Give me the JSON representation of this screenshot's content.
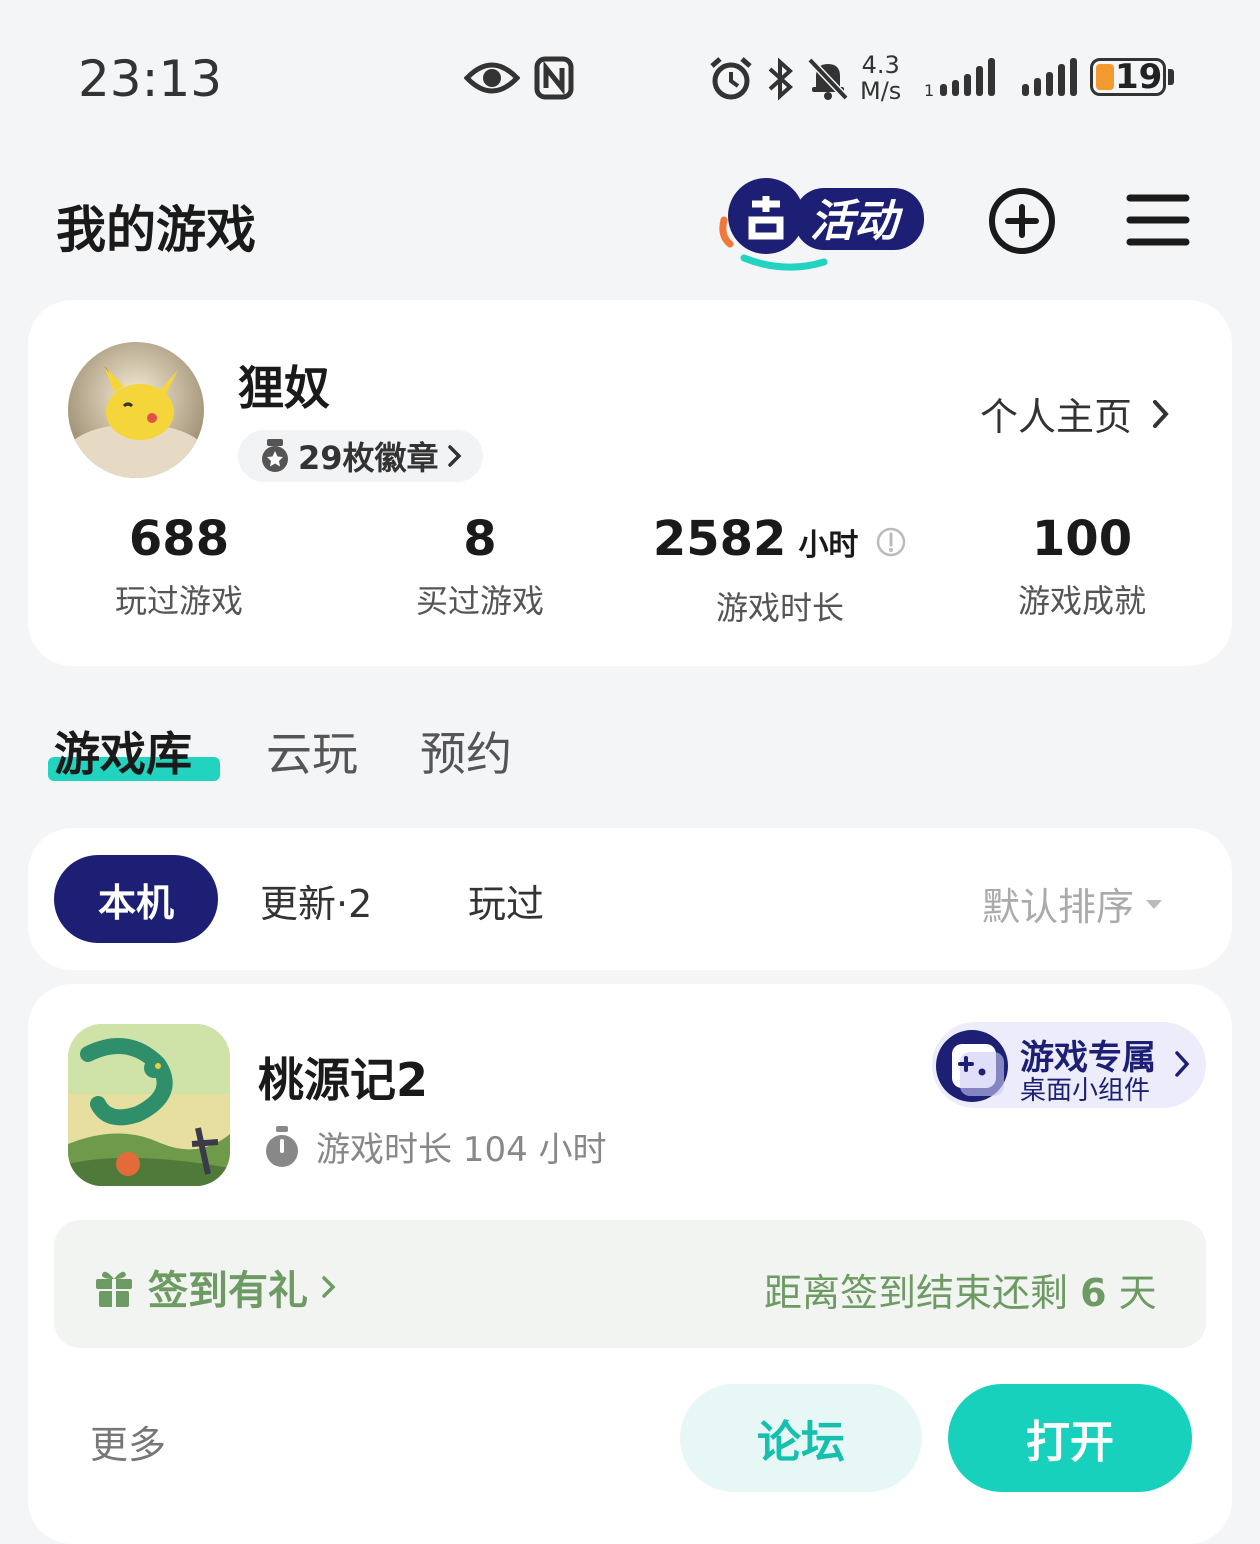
{
  "status_bar": {
    "time": "23:13",
    "speed_value": "4.3",
    "speed_unit": "M/s",
    "battery": "19",
    "icons": [
      "eye-icon",
      "nfc-icon",
      "alarm-icon",
      "bluetooth-icon",
      "mute-bell-icon",
      "signal-icon",
      "signal-icon"
    ]
  },
  "header": {
    "title": "我的游戏",
    "activity_badge_label": "活动"
  },
  "profile": {
    "username": "狸奴",
    "badges_label": "29枚徽章",
    "homepage_label": "个人主页",
    "stats": [
      {
        "value": "688",
        "unit": "",
        "label": "玩过游戏"
      },
      {
        "value": "8",
        "unit": "",
        "label": "买过游戏"
      },
      {
        "value": "2582",
        "unit": "小时",
        "label": "游戏时长"
      },
      {
        "value": "100",
        "unit": "",
        "label": "游戏成就"
      }
    ]
  },
  "tabs": [
    {
      "label": "游戏库",
      "active": true
    },
    {
      "label": "云玩",
      "active": false
    },
    {
      "label": "预约",
      "active": false
    }
  ],
  "filters": {
    "chips": [
      "本机",
      "更新·2",
      "玩过"
    ],
    "active": "本机",
    "sort_label": "默认排序"
  },
  "game": {
    "name": "桃源记2",
    "playtime": "游戏时长 104 小时",
    "widget_title": "游戏专属",
    "widget_sub": "桌面小组件",
    "checkin_label": "签到有礼",
    "checkin_countdown_prefix": "距离签到结束还剩",
    "checkin_days": "6",
    "checkin_unit": "天",
    "more_label": "更多",
    "forum_label": "论坛",
    "open_label": "打开"
  },
  "colors": {
    "accent_teal": "#17d1bc",
    "brand_navy": "#1c1f73",
    "checkin_green": "#6e9a63",
    "battery_orange": "#f29a2e"
  }
}
